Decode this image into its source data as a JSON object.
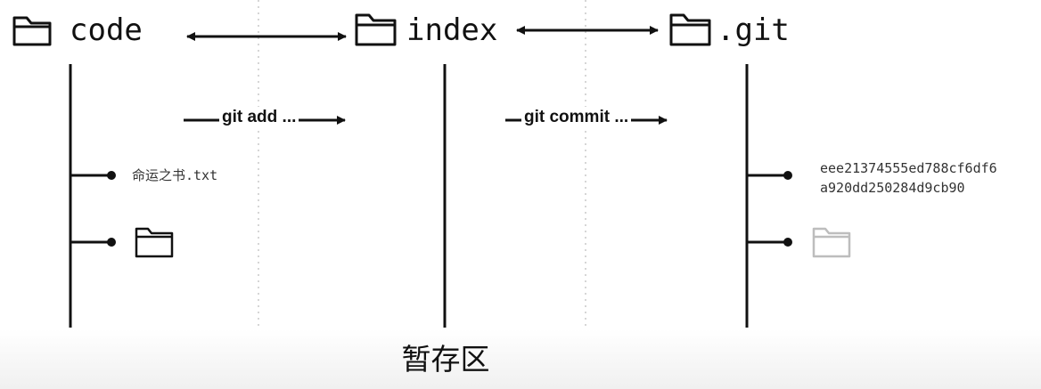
{
  "columns": {
    "code": {
      "title": "code"
    },
    "index": {
      "title": "index"
    },
    "git": {
      "title": ".git"
    }
  },
  "commands": {
    "add": "git add ...",
    "commit": "git commit ..."
  },
  "code_branch": {
    "file_name": "命运之书.txt"
  },
  "git_branch": {
    "hash_line1": "eee21374555ed788cf6df6",
    "hash_line2": "a920dd250284d9cb90"
  },
  "area_label": "暂存区",
  "colors": {
    "line": "#111111",
    "divider": "#c8c8c8",
    "faded_folder": "#bdbdbd"
  }
}
